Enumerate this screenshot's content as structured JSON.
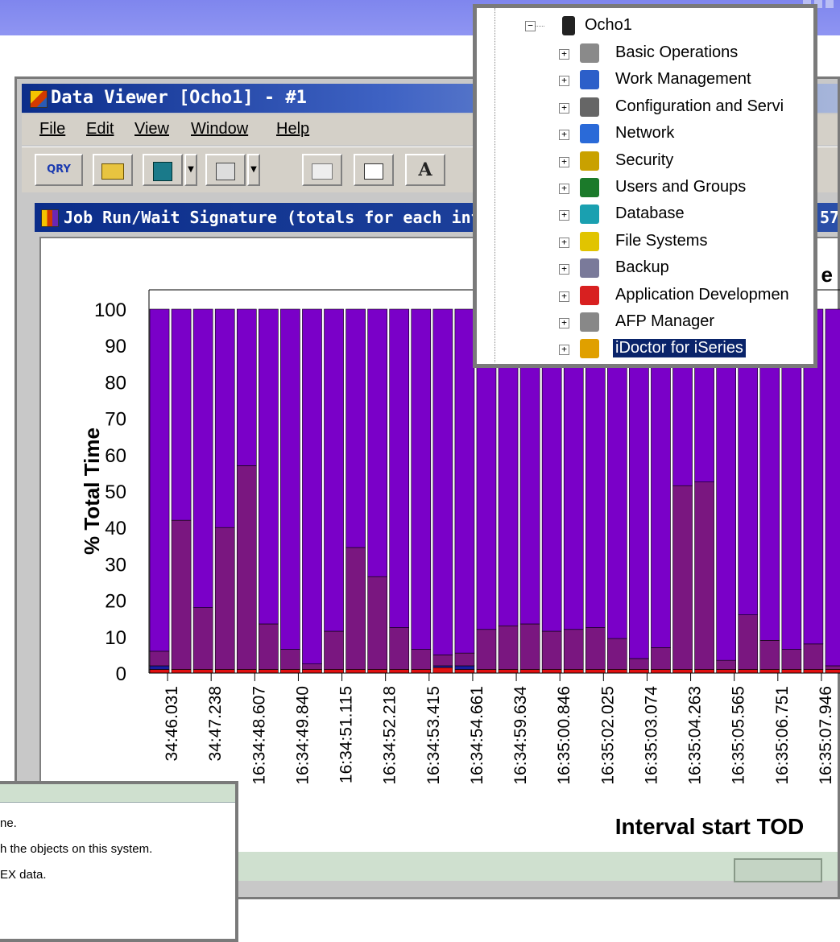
{
  "window": {
    "title": "Data Viewer [Ocho1] - #1",
    "menu": [
      "File",
      "Edit",
      "View",
      "Window",
      "Help"
    ]
  },
  "toolbar": {
    "query_label": "QRY",
    "font_label": "A"
  },
  "graph_window": {
    "title": "Job Run/Wait Signature (totals for each int",
    "title_tail": "57",
    "heading_tail": "e"
  },
  "chart_data": {
    "type": "bar",
    "stacked": true,
    "ylabel": "% Total Time",
    "xlabel": "Interval start TOD",
    "ylim": [
      0,
      100
    ],
    "yticks": [
      0,
      10,
      20,
      30,
      40,
      50,
      60,
      70,
      80,
      90,
      100
    ],
    "tick_labels": [
      "34:46.031",
      "34:47.238",
      "16:34:48.607",
      "16:34:49.840",
      "16:34:51.115",
      "16:34:52.218",
      "16:34:53.415",
      "16:34:54.661",
      "16:34:59.634",
      "16:35:00.846",
      "16:35:02.025",
      "16:35:03.074",
      "16:35:04.263",
      "16:35:05.565",
      "16:35:06.751",
      "16:35:07.946"
    ],
    "series_colors": [
      "#e01010",
      "#1a1aa0",
      "#7a1780",
      "#7a00c8"
    ],
    "bars": [
      [
        1.0,
        1.0,
        4.0,
        94.0
      ],
      [
        1.0,
        0.0,
        41.0,
        58.0
      ],
      [
        1.0,
        0.0,
        17.0,
        82.0
      ],
      [
        1.0,
        0.0,
        39.0,
        60.0
      ],
      [
        1.0,
        0.0,
        56.0,
        43.0
      ],
      [
        1.0,
        0.0,
        12.5,
        86.5
      ],
      [
        1.0,
        0.0,
        5.5,
        93.5
      ],
      [
        1.0,
        0.0,
        1.5,
        97.5
      ],
      [
        1.0,
        0.0,
        10.5,
        88.5
      ],
      [
        1.0,
        0.0,
        33.5,
        65.5
      ],
      [
        1.0,
        0.0,
        25.5,
        73.5
      ],
      [
        1.0,
        0.0,
        11.5,
        87.5
      ],
      [
        1.0,
        0.0,
        5.5,
        93.5
      ],
      [
        1.5,
        0.5,
        3.0,
        95.0
      ],
      [
        1.0,
        1.0,
        3.5,
        94.5
      ],
      [
        1.0,
        0.0,
        11.0,
        88.0
      ],
      [
        1.0,
        0.0,
        12.0,
        87.0
      ],
      [
        1.0,
        0.0,
        12.5,
        86.5
      ],
      [
        1.0,
        0.0,
        10.5,
        88.5
      ],
      [
        1.0,
        0.0,
        11.0,
        88.0
      ],
      [
        1.0,
        0.0,
        11.5,
        87.5
      ],
      [
        1.0,
        0.0,
        8.5,
        90.5
      ],
      [
        1.0,
        0.0,
        3.0,
        96.0
      ],
      [
        1.0,
        0.0,
        6.0,
        93.0
      ],
      [
        1.0,
        0.0,
        50.5,
        48.5
      ],
      [
        1.0,
        0.0,
        51.5,
        47.5
      ],
      [
        1.0,
        0.0,
        2.5,
        96.5
      ],
      [
        1.0,
        0.0,
        15.0,
        84.0
      ],
      [
        1.0,
        0.0,
        8.0,
        91.0
      ],
      [
        1.0,
        0.0,
        5.5,
        93.5
      ],
      [
        1.0,
        0.0,
        7.0,
        92.0
      ],
      [
        1.0,
        0.0,
        1.0,
        98.0
      ]
    ]
  },
  "tree": {
    "root": "Ocho1",
    "items": [
      {
        "label": "Basic Operations",
        "icon": "basic-operations-icon",
        "color": "#8a8a8a"
      },
      {
        "label": "Work Management",
        "icon": "work-management-icon",
        "color": "#2c5fc9"
      },
      {
        "label": "Configuration and Servi",
        "icon": "configuration-icon",
        "color": "#666666"
      },
      {
        "label": "Network",
        "icon": "network-icon",
        "color": "#2a6ad8"
      },
      {
        "label": "Security",
        "icon": "security-icon",
        "color": "#c9a100"
      },
      {
        "label": "Users and Groups",
        "icon": "users-groups-icon",
        "color": "#1b7a2a"
      },
      {
        "label": "Database",
        "icon": "database-icon",
        "color": "#1aa0b0"
      },
      {
        "label": "File Systems",
        "icon": "file-systems-icon",
        "color": "#e1c400"
      },
      {
        "label": "Backup",
        "icon": "backup-icon",
        "color": "#7a7a9a"
      },
      {
        "label": "Application Developmen",
        "icon": "application-development-icon",
        "color": "#d82020"
      },
      {
        "label": "AFP Manager",
        "icon": "afp-manager-icon",
        "color": "#888888"
      },
      {
        "label": "iDoctor for iSeries",
        "icon": "idoctor-icon",
        "color": "#e0a000",
        "selected": true
      }
    ]
  },
  "dialog": {
    "lines": [
      "ne.",
      "h the objects on this system.",
      "EX data."
    ]
  }
}
